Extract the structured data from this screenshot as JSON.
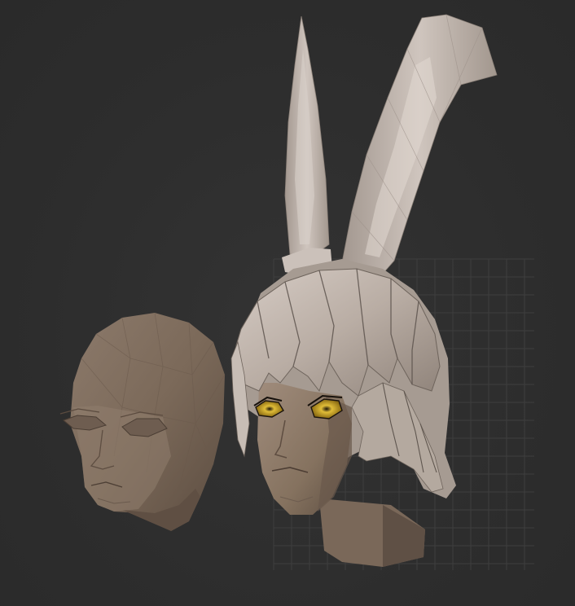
{
  "viewport": {
    "background_color": "#2e2e2e",
    "grid_color": "#3e3e3e"
  },
  "scene": {
    "objects": [
      {
        "name": "low-poly-head-base",
        "color": "#7d6b5c"
      },
      {
        "name": "stylized-rabbit-eared-character-head",
        "skin_color": "#8a7868",
        "hair_color": "#bcb2ab",
        "eye_color": "#d8b632"
      }
    ]
  }
}
